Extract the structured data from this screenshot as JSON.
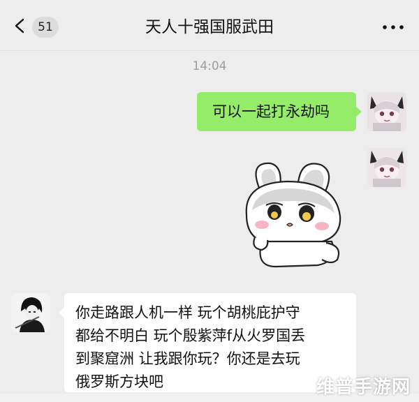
{
  "header": {
    "unread_count": "51",
    "title": "天人十强国服武田"
  },
  "timestamp": "14:04",
  "messages": {
    "outgoing_text": "可以一起打永劫吗",
    "incoming_lines": [
      "你走路跟人机一样 玩个胡桃庇护守",
      "都给不明白 玩个殷紫萍f从火罗国丢",
      "到聚窟洲 让我跟你玩？你还是去玩",
      "俄罗斯方块吧"
    ]
  },
  "watermark": "维普手游网",
  "colors": {
    "background": "#ededed",
    "outgoing_bubble": "#95ec69",
    "incoming_bubble": "#ffffff"
  },
  "icons": {
    "back": "back-chevron-icon",
    "more": "more-dots-icon"
  }
}
